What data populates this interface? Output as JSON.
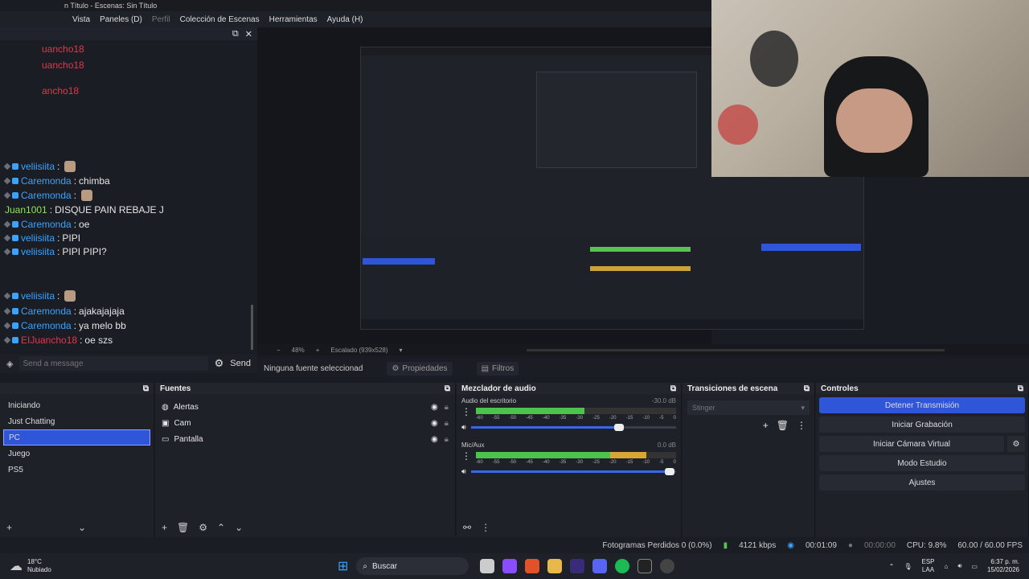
{
  "window": {
    "title": "n Título - Escenas: Sin Título"
  },
  "menu": [
    "Vista",
    "Paneles (D)",
    "Perfil",
    "Colección de Escenas",
    "Herramientas",
    "Ayuda (H)"
  ],
  "chat": {
    "lines": [
      {
        "user": "veliisiita",
        "user_color": "#3aa3ff",
        "text": "",
        "emote": true
      },
      {
        "user": "Caremonda",
        "user_color": "#3aa3ff",
        "text": "chimba",
        "emote": false
      },
      {
        "user": "Caremonda",
        "user_color": "#3aa3ff",
        "text": "",
        "emote": true
      },
      {
        "user": "Juan1001",
        "user_color": "#8fe35a",
        "text": "DISQUE PAIN REBAJE J",
        "emote": false
      },
      {
        "user": "Caremonda",
        "user_color": "#3aa3ff",
        "text": "oe",
        "emote": false
      },
      {
        "user": "veliisiita",
        "user_color": "#3aa3ff",
        "text": "PIPI",
        "emote": false
      },
      {
        "user": "veliisiita",
        "user_color": "#3aa3ff",
        "text": "PIPI PIPI?",
        "emote": false
      },
      {
        "user": "veliisiita",
        "user_color": "#3aa3ff",
        "text": "",
        "emote": true
      },
      {
        "user": "Caremonda",
        "user_color": "#3aa3ff",
        "text": "ajakajajaja",
        "emote": false
      },
      {
        "user": "Caremonda",
        "user_color": "#3aa3ff",
        "text": "ya melo bb",
        "emote": false
      },
      {
        "user": "EIJuancho18",
        "user_color": "#e3364a",
        "text": "oe szs",
        "emote": false
      }
    ],
    "top_users": [
      "uancho18",
      "uancho18",
      "ancho18"
    ],
    "placeholder": "Send a message",
    "send_label": "Send"
  },
  "zoom": {
    "percent": "48%",
    "scaled": "Escalado (939x528)"
  },
  "source_toolbar": {
    "no_source": "Ninguna fuente seleccionad",
    "properties": "Propiedades",
    "filters": "Filtros"
  },
  "scenes": {
    "items": [
      "Iniciando",
      "Just Chatting",
      "PC",
      "Juego",
      "PS5"
    ],
    "selected": "PC"
  },
  "sources": {
    "title": "Fuentes",
    "items": [
      {
        "name": "Alertas",
        "icon": "globe-icon"
      },
      {
        "name": "Cam",
        "icon": "camera-icon"
      },
      {
        "name": "Pantalla",
        "icon": "monitor-icon"
      }
    ]
  },
  "mixer": {
    "title": "Mezclador de audio",
    "channels": [
      {
        "name": "Audio del escritorio",
        "db": "-30.0 dB",
        "level": 0.55,
        "slider": 0.72
      },
      {
        "name": "Mic/Aux",
        "db": "0.0 dB",
        "level": 0.86,
        "slider": 0.97
      }
    ],
    "ticks": [
      "-60",
      "-55",
      "-50",
      "-45",
      "-40",
      "-35",
      "-30",
      "-25",
      "-20",
      "-15",
      "-10",
      "-5",
      "0"
    ]
  },
  "transitions": {
    "title": "Transiciones de escena",
    "selected": "Stinger"
  },
  "controls": {
    "title": "Controles",
    "buttons": [
      "Detener Transmisión",
      "Iniciar Grabación",
      "Iniciar Cámara Virtual",
      "Modo Estudio",
      "Ajustes"
    ]
  },
  "status": {
    "dropped": "Fotogramas Perdidos 0 (0.0%)",
    "bitrate": "4121 kbps",
    "stream_time": "00:01:09",
    "rec_time": "00:00:00",
    "cpu": "CPU: 9.8%",
    "fps": "60.00 / 60.00 FPS"
  },
  "taskbar": {
    "weather_temp": "18°C",
    "weather_desc": "Nubiado",
    "search": "Buscar",
    "lang": "ESP",
    "lang2": "LAA",
    "time": "6:37 p. m.",
    "date": "15/02/2026"
  },
  "colors": {
    "accent": "#2f56d8",
    "panel": "#1f2129",
    "bg": "#1a1c23"
  }
}
